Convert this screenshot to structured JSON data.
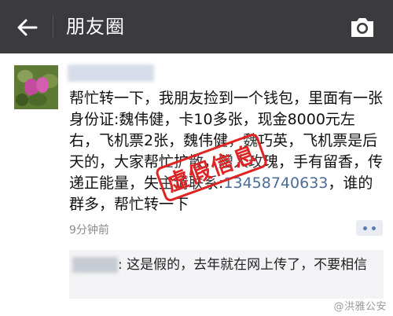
{
  "header": {
    "title": "朋友圈"
  },
  "post": {
    "text_main": "帮忙转一下，我朋友捡到一个钱包，里面有一张身份证:魏伟健，卡10多张，现金8000元左右，飞机票2张，魏伟健，魏巧英，飞机票是后天的，大家帮忙扩散，赠人玫瑰，手有留香，传递正能量，失主请联系:",
    "phone": "13458740633",
    "text_tail": "，谁的群多，帮忙转一下",
    "time": "9分钟前"
  },
  "stamp": {
    "label": "虚假信息"
  },
  "comment": {
    "separator": ": ",
    "text": "这是假的，去年就在网上传了，不要相信"
  },
  "watermark": {
    "text": "@洪雅公安"
  },
  "colors": {
    "header_bg": "#3a3a3f",
    "link": "#4a6b9c",
    "stamp": "#e02424"
  },
  "icons": {
    "back": "arrow-left-icon",
    "camera": "camera-icon",
    "more": "more-dots-icon"
  }
}
